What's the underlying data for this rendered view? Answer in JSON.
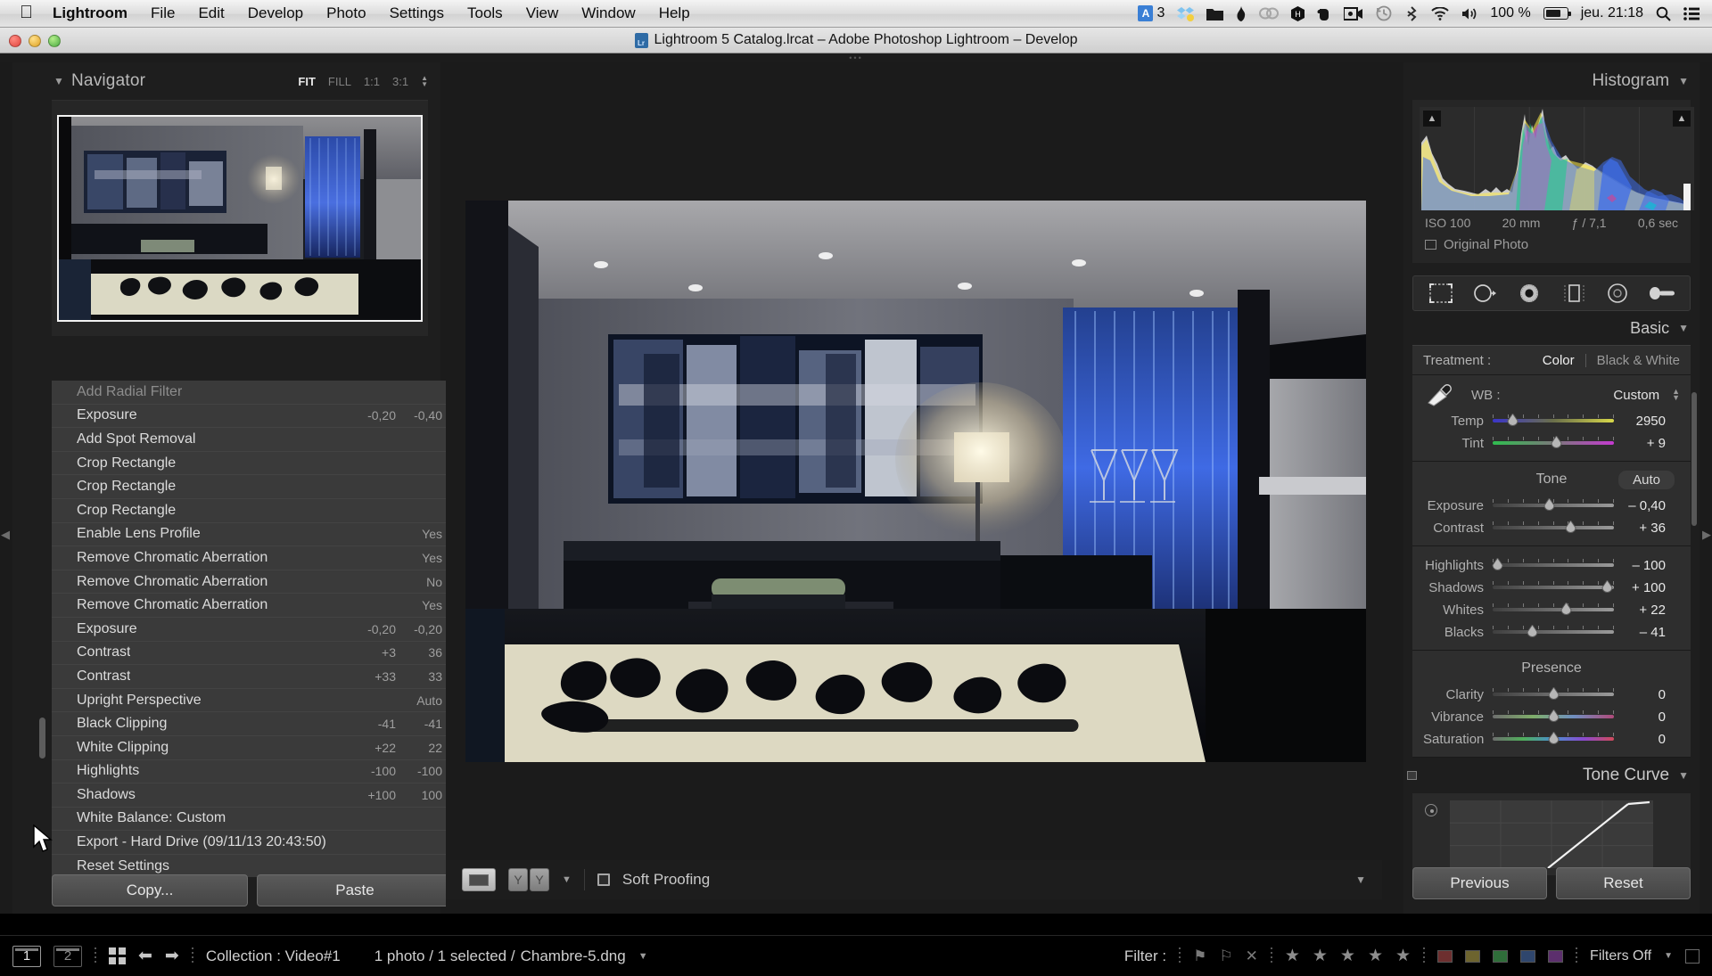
{
  "menubar": {
    "apple": "apple-logo",
    "app_name": "Lightroom",
    "items": [
      "File",
      "Edit",
      "Develop",
      "Photo",
      "Settings",
      "Tools",
      "View",
      "Window",
      "Help"
    ],
    "status_items": [
      {
        "name": "adobe-creative-cloud-count",
        "label": "3"
      },
      {
        "name": "dropbox-icon",
        "label": ""
      },
      {
        "name": "folder-icon",
        "label": ""
      },
      {
        "name": "flame-icon",
        "label": ""
      },
      {
        "name": "creative-cloud-icon",
        "label": ""
      },
      {
        "name": "hazel-icon",
        "label": ""
      },
      {
        "name": "evernote-icon",
        "label": ""
      },
      {
        "name": "screen-recorder-icon",
        "label": ""
      },
      {
        "name": "time-machine-icon",
        "label": ""
      },
      {
        "name": "bluetooth-icon",
        "label": ""
      },
      {
        "name": "wifi-icon",
        "label": ""
      },
      {
        "name": "volume-icon",
        "label": ""
      }
    ],
    "battery_percent": "100 %",
    "clock": "jeu. 21:18",
    "search_icon": "search-icon",
    "notification_icon": "notification-center-icon"
  },
  "titlebar": {
    "title": "Lightroom 5 Catalog.lrcat – Adobe Photoshop Lightroom – Develop"
  },
  "navigator": {
    "title": "Navigator",
    "zoom_modes": [
      "FIT",
      "FILL",
      "1:1",
      "3:1"
    ],
    "active_zoom": "FIT"
  },
  "history": {
    "rows": [
      {
        "name": "Add Radial Filter",
        "delta": "",
        "value": ""
      },
      {
        "name": "Exposure",
        "delta": "-0,20",
        "value": "-0,40"
      },
      {
        "name": "Add Spot Removal",
        "delta": "",
        "value": ""
      },
      {
        "name": "Crop Rectangle",
        "delta": "",
        "value": ""
      },
      {
        "name": "Crop Rectangle",
        "delta": "",
        "value": ""
      },
      {
        "name": "Crop Rectangle",
        "delta": "",
        "value": ""
      },
      {
        "name": "Enable Lens Profile",
        "delta": "",
        "value": "Yes"
      },
      {
        "name": "Remove Chromatic Aberration",
        "delta": "",
        "value": "Yes"
      },
      {
        "name": "Remove Chromatic Aberration",
        "delta": "",
        "value": "No"
      },
      {
        "name": "Remove Chromatic Aberration",
        "delta": "",
        "value": "Yes"
      },
      {
        "name": "Exposure",
        "delta": "-0,20",
        "value": "-0,20"
      },
      {
        "name": "Contrast",
        "delta": "+3",
        "value": "36"
      },
      {
        "name": "Contrast",
        "delta": "+33",
        "value": "33"
      },
      {
        "name": "Upright Perspective",
        "delta": "",
        "value": "Auto"
      },
      {
        "name": "Black Clipping",
        "delta": "-41",
        "value": "-41"
      },
      {
        "name": "White Clipping",
        "delta": "+22",
        "value": "22"
      },
      {
        "name": "Highlights",
        "delta": "-100",
        "value": "-100"
      },
      {
        "name": "Shadows",
        "delta": "+100",
        "value": "100"
      },
      {
        "name": "White Balance: Custom",
        "delta": "",
        "value": ""
      },
      {
        "name": "Export - Hard Drive (09/11/13 20:43:50)",
        "delta": "",
        "value": ""
      },
      {
        "name": "Reset Settings",
        "delta": "",
        "value": ""
      }
    ],
    "copy_label": "Copy...",
    "paste_label": "Paste"
  },
  "toolbar": {
    "view_icon": "loupe-view-icon",
    "before_after_icon": "before-after-icon",
    "soft_proofing_label": "Soft Proofing",
    "soft_proofing_checked": false
  },
  "histogram": {
    "title": "Histogram",
    "iso": "ISO 100",
    "focal": "20 mm",
    "aperture": "ƒ / 7,1",
    "shutter": "0,6 sec",
    "original_photo_label": "Original Photo"
  },
  "tools": [
    {
      "name": "crop-overlay-tool"
    },
    {
      "name": "spot-removal-tool"
    },
    {
      "name": "red-eye-correction-tool"
    },
    {
      "name": "graduated-filter-tool"
    },
    {
      "name": "radial-filter-tool"
    },
    {
      "name": "adjustment-brush-tool"
    }
  ],
  "basic": {
    "title": "Basic",
    "treatment_label": "Treatment :",
    "treatment_color": "Color",
    "treatment_bw": "Black & White",
    "treatment_active": "Color",
    "wb_label": "WB :",
    "wb_value": "Custom",
    "wb_sliders": [
      {
        "label": "Temp",
        "value": "2950",
        "pos": 16,
        "type": "temp"
      },
      {
        "label": "Tint",
        "value": "+ 9",
        "pos": 52,
        "type": "tint"
      }
    ],
    "tone_title": "Tone",
    "auto_label": "Auto",
    "tone_sliders": [
      {
        "label": "Exposure",
        "value": "– 0,40",
        "pos": 46,
        "type": "gray"
      },
      {
        "label": "Contrast",
        "value": "+ 36",
        "pos": 64,
        "type": "gray"
      }
    ],
    "tone_sliders2": [
      {
        "label": "Highlights",
        "value": "– 100",
        "pos": 4,
        "type": "gray"
      },
      {
        "label": "Shadows",
        "value": "+ 100",
        "pos": 94,
        "type": "gray"
      },
      {
        "label": "Whites",
        "value": "+ 22",
        "pos": 60,
        "type": "gray"
      },
      {
        "label": "Blacks",
        "value": "– 41",
        "pos": 32,
        "type": "gray"
      }
    ],
    "presence_title": "Presence",
    "presence_sliders": [
      {
        "label": "Clarity",
        "value": "0",
        "pos": 50,
        "type": "gray"
      },
      {
        "label": "Vibrance",
        "value": "0",
        "pos": 50,
        "type": "vibrance"
      },
      {
        "label": "Saturation",
        "value": "0",
        "pos": 50,
        "type": "saturation"
      }
    ]
  },
  "tonecurve": {
    "title": "Tone Curve"
  },
  "footer_buttons": {
    "previous": "Previous",
    "reset": "Reset"
  },
  "statusbar": {
    "module_1": "1",
    "module_2": "2",
    "grid_icon": "grid-view-icon",
    "prev_icon": "previous-photo-icon",
    "next_icon": "next-photo-icon",
    "collection": "Collection : Video#1",
    "photo_count": "1 photo / 1 selected /",
    "filename": "Chambre-5.dng",
    "filter_label": "Filter :",
    "filters_off": "Filters Off",
    "star_count": 5
  },
  "colors": {
    "panel_bg": "#1e1e1e",
    "list_bg": "#3a3a3a",
    "accent_text": "#e8e8e8",
    "menubar_bg": "#dcdcdc"
  }
}
